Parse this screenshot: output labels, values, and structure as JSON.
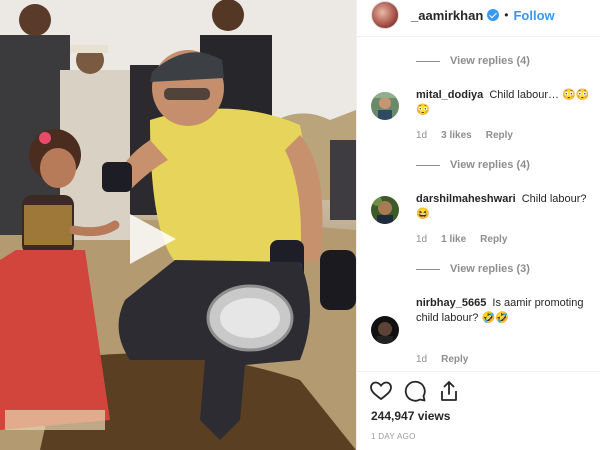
{
  "post": {
    "username": "_aamirkhan",
    "separator": "•",
    "follow_label": "Follow"
  },
  "comments": [
    {
      "view_replies": "View replies (4)"
    },
    {
      "username": "mital_dodiya",
      "text": "Child labour…",
      "emoji": "😳😳😳",
      "time": "1d",
      "likes": "3 likes",
      "reply": "Reply",
      "view_replies": "View replies (4)"
    },
    {
      "username": "darshilmaheshwari",
      "text": "Child labour?",
      "emoji": "😆",
      "time": "1d",
      "likes": "1 like",
      "reply": "Reply",
      "view_replies": "View replies (3)"
    },
    {
      "username": "nirbhay_5665",
      "text": "Is aamir promoting child labour?",
      "emoji": "🤣🤣",
      "time": "1d",
      "reply": "Reply"
    }
  ],
  "actions": {
    "like_icon": "heart-icon",
    "comment_icon": "comment-icon",
    "share_icon": "share-icon"
  },
  "stats": {
    "views": "244,947 views",
    "posted": "1 DAY AGO"
  },
  "colors": {
    "link": "#3897f0",
    "muted": "#8e8e8e",
    "text": "#262626"
  }
}
